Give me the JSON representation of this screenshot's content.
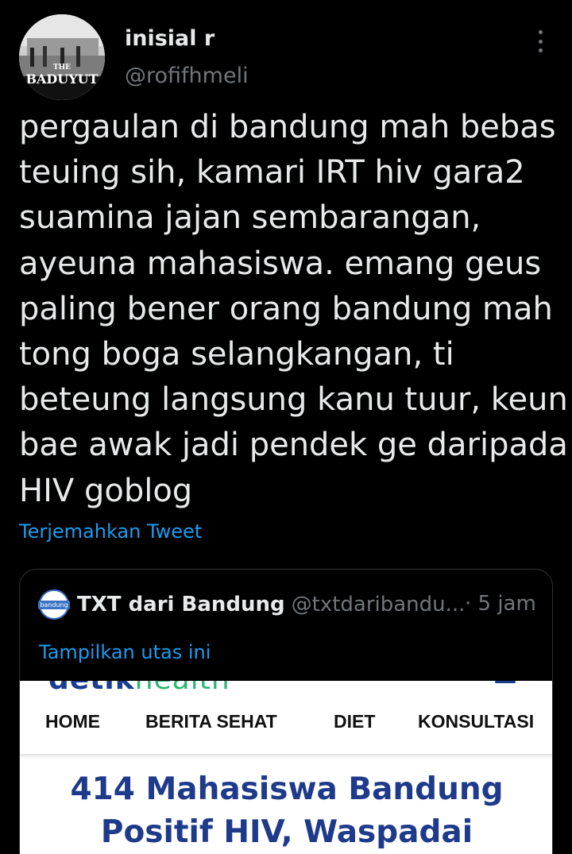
{
  "author": {
    "name": "inisial r",
    "handle": "@rofifhmeli",
    "avatar_text_top": "THE",
    "avatar_text_main": "BADUYUT"
  },
  "more_icon": "more-vertical-icon",
  "tweet": {
    "lines": [
      "pergaulan di bandung mah bebas",
      "teuing sih, kamari IRT hiv gara2",
      "suamina jajan sembarangan,",
      "ayeuna mahasiswa. emang geus",
      "paling bener orang bandung mah",
      "tong boga selangkangan, ti",
      "beteung langsung kanu tuur, keun",
      "bae awak jadi pendek ge daripada",
      "HIV goblog"
    ],
    "translate_label": "Terjemahkan Tweet"
  },
  "quote": {
    "avatar_label": "bandung",
    "name": "TXT dari Bandung",
    "handle": "@txtdaribandu...",
    "time": "· 5 jam",
    "show_thread": "Tampilkan utas ini",
    "article": {
      "logo_main": "detik",
      "logo_sub": "health",
      "nav": [
        "HOME",
        "BERITA SEHAT",
        "DIET",
        "KONSULTASI"
      ],
      "headline_lines": [
        "414 Mahasiswa Bandung",
        "Positif HIV, Waspadai"
      ]
    }
  },
  "colors": {
    "background": "#000000",
    "link": "#1d9bf0",
    "muted": "#71767b",
    "headline": "#1e3a8a"
  }
}
